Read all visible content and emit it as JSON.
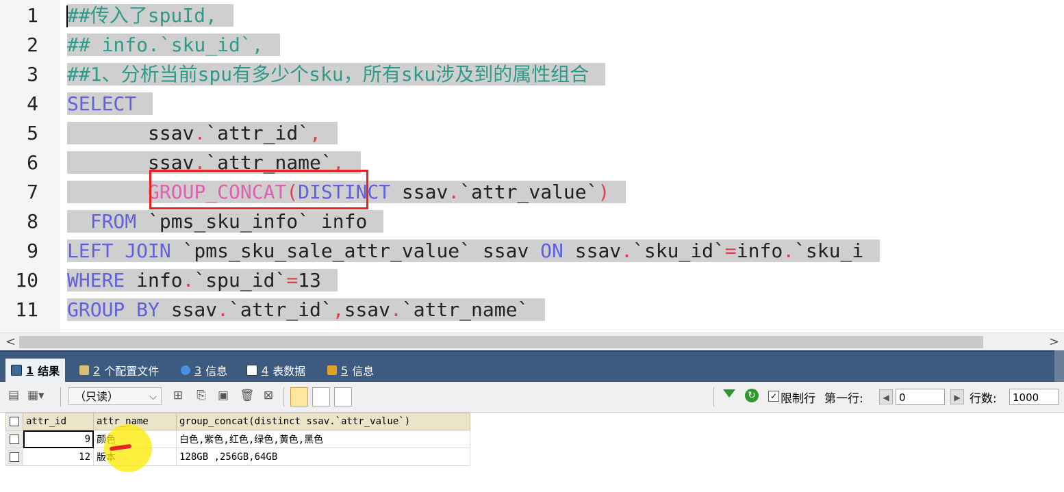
{
  "editor": {
    "line_numbers": [
      "1",
      "2",
      "3",
      "4",
      "5",
      "6",
      "7",
      "8",
      "9",
      "10",
      "11"
    ],
    "lines": [
      [
        {
          "t": "##传入了spuId,",
          "c": "cm"
        }
      ],
      [
        {
          "t": "## info.`sku_id`,",
          "c": "cm"
        }
      ],
      [
        {
          "t": "##1、分析当前spu有多少个sku，所有sku涉及到的属性组合",
          "c": "cm"
        }
      ],
      [
        {
          "t": "SELECT",
          "c": "kw"
        }
      ],
      [
        {
          "t": "\t",
          "c": "id"
        },
        {
          "t": "ssav",
          "c": "id"
        },
        {
          "t": ".",
          "c": "op"
        },
        {
          "t": "`attr_id`",
          "c": "id"
        },
        {
          "t": ",",
          "c": "op"
        }
      ],
      [
        {
          "t": "\t",
          "c": "id"
        },
        {
          "t": "ssav",
          "c": "id"
        },
        {
          "t": ".",
          "c": "op"
        },
        {
          "t": "`attr_name`",
          "c": "id"
        },
        {
          "t": ",",
          "c": "op"
        }
      ],
      [
        {
          "t": "\t",
          "c": "id"
        },
        {
          "t": "GROUP_CONCAT",
          "c": "fn"
        },
        {
          "t": "(",
          "c": "op"
        },
        {
          "t": "DISTINCT",
          "c": "kw"
        },
        {
          "t": " ssav",
          "c": "id"
        },
        {
          "t": ".",
          "c": "op"
        },
        {
          "t": "`attr_value`",
          "c": "id"
        },
        {
          "t": ")",
          "c": "op"
        }
      ],
      [
        {
          "t": "  ",
          "c": "id"
        },
        {
          "t": "FROM",
          "c": "kw"
        },
        {
          "t": " `pms_sku_info` info",
          "c": "id"
        }
      ],
      [
        {
          "t": "LEFT JOIN",
          "c": "kw"
        },
        {
          "t": " `pms_sku_sale_attr_value` ssav ",
          "c": "id"
        },
        {
          "t": "ON",
          "c": "kw"
        },
        {
          "t": " ssav",
          "c": "id"
        },
        {
          "t": ".",
          "c": "op"
        },
        {
          "t": "`sku_id`",
          "c": "id"
        },
        {
          "t": "=",
          "c": "op"
        },
        {
          "t": "info",
          "c": "id"
        },
        {
          "t": ".",
          "c": "op"
        },
        {
          "t": "`sku_i",
          "c": "id"
        }
      ],
      [
        {
          "t": "WHERE",
          "c": "kw"
        },
        {
          "t": " info",
          "c": "id"
        },
        {
          "t": ".",
          "c": "op"
        },
        {
          "t": "`spu_id`",
          "c": "id"
        },
        {
          "t": "=",
          "c": "op"
        },
        {
          "t": "13",
          "c": "num"
        }
      ],
      [
        {
          "t": "GROUP BY",
          "c": "kw"
        },
        {
          "t": " ssav",
          "c": "id"
        },
        {
          "t": ".",
          "c": "op"
        },
        {
          "t": "`attr_id`",
          "c": "id"
        },
        {
          "t": ",",
          "c": "op"
        },
        {
          "t": "ssav",
          "c": "id"
        },
        {
          "t": ".",
          "c": "op"
        },
        {
          "t": "`attr_name`",
          "c": "id"
        }
      ]
    ]
  },
  "scrollbar": {
    "left_arrow": "<",
    "right_arrow": ">"
  },
  "tabs": [
    {
      "num": "1",
      "label": "结果",
      "icon": "result-grid-icon",
      "active": true
    },
    {
      "num": "2",
      "label": "个配置文件",
      "icon": "profile-icon",
      "active": false
    },
    {
      "num": "3",
      "label": "信息",
      "icon": "info-icon",
      "active": false
    },
    {
      "num": "4",
      "label": "表数据",
      "icon": "table-data-icon",
      "active": false
    },
    {
      "num": "5",
      "label": "信息",
      "icon": "info-icon-2",
      "active": false
    }
  ],
  "toolbar": {
    "mode_select": "（只读）",
    "limit_label": "限制行",
    "first_row_label": "第一行:",
    "first_row_value": "0",
    "rows_label": "行数:",
    "rows_value": "1000"
  },
  "results": {
    "columns": [
      "attr_id",
      "attr_name",
      "group_concat(distinct ssav.`attr_value`)"
    ],
    "rows": [
      [
        "9",
        "颜色",
        "白色,紫色,红色,绿色,黄色,黑色"
      ],
      [
        "12",
        "版本",
        "128GB ,256GB,64GB"
      ]
    ]
  },
  "colors": {
    "comment": "#2e9a8a",
    "keyword": "#6060e0",
    "function": "#e060b0",
    "operator": "#e04050",
    "selection": "#cfcfcf",
    "annotation_box": "#e82020",
    "tabbar": "#3d5a80"
  }
}
